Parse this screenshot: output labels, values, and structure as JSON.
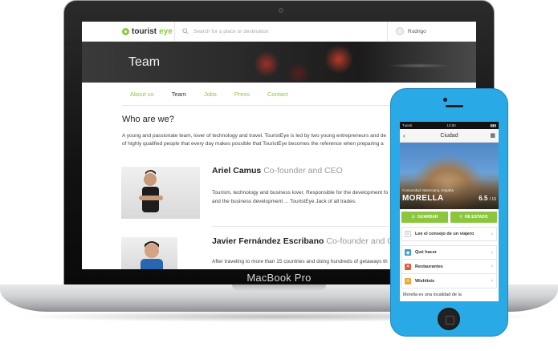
{
  "laptop": {
    "brand_label": "MacBook Pro",
    "site": {
      "logo": {
        "part1": "tourist",
        "part2": "eye"
      },
      "search_placeholder": "Search for a place or destination",
      "user_name": "Rodrigo",
      "banner_title": "Team",
      "tabs": [
        {
          "label": "About us"
        },
        {
          "label": "Team"
        },
        {
          "label": "Jobs"
        },
        {
          "label": "Press"
        },
        {
          "label": "Contact"
        }
      ],
      "heading": "Who are we?",
      "intro_lines": [
        "A young and passionate team, lover of technology and travel. TouristEye is led by two young entrepreneurs and de",
        "of highly qualified people that every day makes possible that TouristEye becomes the reference when preparing a"
      ],
      "people": [
        {
          "name": "Ariel Camus",
          "role": "Co-founder and CEO",
          "bio_lines": [
            "Tourism, technology and business lover. Responsible for the development fo",
            "and the business development ... TouristEye Jack of all trades."
          ]
        },
        {
          "name": "Javier Fernández Escribano",
          "role": "Co-founder and CT",
          "bio_lines": [
            "After traveling to more than 15 countries and doing hundreds of getaways th"
          ]
        }
      ]
    }
  },
  "phone": {
    "status": {
      "carrier": "Tuenti",
      "time": "12:50"
    },
    "nav_title": "Ciudad",
    "region": "Comunidad Valenciana, España",
    "city": "MORELLA",
    "score": "6.5",
    "score_max": "/ 10",
    "actions": [
      {
        "label": "GUARDAR",
        "icon": "list-icon"
      },
      {
        "label": "HE ESTADO",
        "icon": "location-pin-icon"
      }
    ],
    "advice_row": "Lee el consejo de un viajero",
    "menu": [
      {
        "label": "Qué hacer",
        "icon": "eye-icon",
        "color": "#3a97d4"
      },
      {
        "label": "Restaurantes",
        "icon": "fork-knife-icon",
        "color": "#e05a3a"
      },
      {
        "label": "Wishlists",
        "icon": "list-icon",
        "color": "#e8a83a"
      }
    ],
    "description": "Morella es una localidad de la"
  },
  "colors": {
    "accent_green": "#8cc63f",
    "phone_body": "#29a9e6"
  }
}
